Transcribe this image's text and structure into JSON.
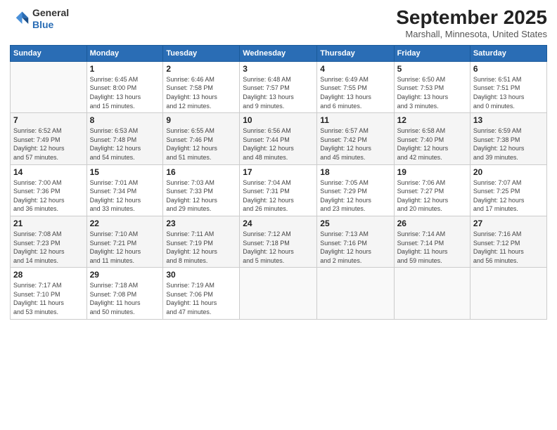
{
  "logo": {
    "line1": "General",
    "line2": "Blue"
  },
  "title": "September 2025",
  "location": "Marshall, Minnesota, United States",
  "weekdays": [
    "Sunday",
    "Monday",
    "Tuesday",
    "Wednesday",
    "Thursday",
    "Friday",
    "Saturday"
  ],
  "weeks": [
    [
      {
        "day": "",
        "info": ""
      },
      {
        "day": "1",
        "info": "Sunrise: 6:45 AM\nSunset: 8:00 PM\nDaylight: 13 hours\nand 15 minutes."
      },
      {
        "day": "2",
        "info": "Sunrise: 6:46 AM\nSunset: 7:58 PM\nDaylight: 13 hours\nand 12 minutes."
      },
      {
        "day": "3",
        "info": "Sunrise: 6:48 AM\nSunset: 7:57 PM\nDaylight: 13 hours\nand 9 minutes."
      },
      {
        "day": "4",
        "info": "Sunrise: 6:49 AM\nSunset: 7:55 PM\nDaylight: 13 hours\nand 6 minutes."
      },
      {
        "day": "5",
        "info": "Sunrise: 6:50 AM\nSunset: 7:53 PM\nDaylight: 13 hours\nand 3 minutes."
      },
      {
        "day": "6",
        "info": "Sunrise: 6:51 AM\nSunset: 7:51 PM\nDaylight: 13 hours\nand 0 minutes."
      }
    ],
    [
      {
        "day": "7",
        "info": "Sunrise: 6:52 AM\nSunset: 7:49 PM\nDaylight: 12 hours\nand 57 minutes."
      },
      {
        "day": "8",
        "info": "Sunrise: 6:53 AM\nSunset: 7:48 PM\nDaylight: 12 hours\nand 54 minutes."
      },
      {
        "day": "9",
        "info": "Sunrise: 6:55 AM\nSunset: 7:46 PM\nDaylight: 12 hours\nand 51 minutes."
      },
      {
        "day": "10",
        "info": "Sunrise: 6:56 AM\nSunset: 7:44 PM\nDaylight: 12 hours\nand 48 minutes."
      },
      {
        "day": "11",
        "info": "Sunrise: 6:57 AM\nSunset: 7:42 PM\nDaylight: 12 hours\nand 45 minutes."
      },
      {
        "day": "12",
        "info": "Sunrise: 6:58 AM\nSunset: 7:40 PM\nDaylight: 12 hours\nand 42 minutes."
      },
      {
        "day": "13",
        "info": "Sunrise: 6:59 AM\nSunset: 7:38 PM\nDaylight: 12 hours\nand 39 minutes."
      }
    ],
    [
      {
        "day": "14",
        "info": "Sunrise: 7:00 AM\nSunset: 7:36 PM\nDaylight: 12 hours\nand 36 minutes."
      },
      {
        "day": "15",
        "info": "Sunrise: 7:01 AM\nSunset: 7:34 PM\nDaylight: 12 hours\nand 33 minutes."
      },
      {
        "day": "16",
        "info": "Sunrise: 7:03 AM\nSunset: 7:33 PM\nDaylight: 12 hours\nand 29 minutes."
      },
      {
        "day": "17",
        "info": "Sunrise: 7:04 AM\nSunset: 7:31 PM\nDaylight: 12 hours\nand 26 minutes."
      },
      {
        "day": "18",
        "info": "Sunrise: 7:05 AM\nSunset: 7:29 PM\nDaylight: 12 hours\nand 23 minutes."
      },
      {
        "day": "19",
        "info": "Sunrise: 7:06 AM\nSunset: 7:27 PM\nDaylight: 12 hours\nand 20 minutes."
      },
      {
        "day": "20",
        "info": "Sunrise: 7:07 AM\nSunset: 7:25 PM\nDaylight: 12 hours\nand 17 minutes."
      }
    ],
    [
      {
        "day": "21",
        "info": "Sunrise: 7:08 AM\nSunset: 7:23 PM\nDaylight: 12 hours\nand 14 minutes."
      },
      {
        "day": "22",
        "info": "Sunrise: 7:10 AM\nSunset: 7:21 PM\nDaylight: 12 hours\nand 11 minutes."
      },
      {
        "day": "23",
        "info": "Sunrise: 7:11 AM\nSunset: 7:19 PM\nDaylight: 12 hours\nand 8 minutes."
      },
      {
        "day": "24",
        "info": "Sunrise: 7:12 AM\nSunset: 7:18 PM\nDaylight: 12 hours\nand 5 minutes."
      },
      {
        "day": "25",
        "info": "Sunrise: 7:13 AM\nSunset: 7:16 PM\nDaylight: 12 hours\nand 2 minutes."
      },
      {
        "day": "26",
        "info": "Sunrise: 7:14 AM\nSunset: 7:14 PM\nDaylight: 11 hours\nand 59 minutes."
      },
      {
        "day": "27",
        "info": "Sunrise: 7:16 AM\nSunset: 7:12 PM\nDaylight: 11 hours\nand 56 minutes."
      }
    ],
    [
      {
        "day": "28",
        "info": "Sunrise: 7:17 AM\nSunset: 7:10 PM\nDaylight: 11 hours\nand 53 minutes."
      },
      {
        "day": "29",
        "info": "Sunrise: 7:18 AM\nSunset: 7:08 PM\nDaylight: 11 hours\nand 50 minutes."
      },
      {
        "day": "30",
        "info": "Sunrise: 7:19 AM\nSunset: 7:06 PM\nDaylight: 11 hours\nand 47 minutes."
      },
      {
        "day": "",
        "info": ""
      },
      {
        "day": "",
        "info": ""
      },
      {
        "day": "",
        "info": ""
      },
      {
        "day": "",
        "info": ""
      }
    ]
  ]
}
